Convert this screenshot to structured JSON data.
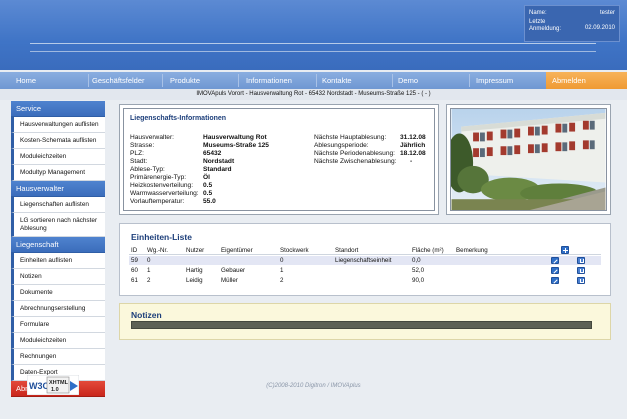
{
  "user": {
    "name_label": "Name:",
    "name_value": "tester",
    "last_login_label_1": "Letzte",
    "last_login_label_2": "Anmeldung:",
    "last_login_value": "02.09.2010"
  },
  "nav": [
    {
      "label": "Home"
    },
    {
      "label": "Geschäftsfelder"
    },
    {
      "label": "Produkte"
    },
    {
      "label": "Informationen"
    },
    {
      "label": "Kontakte"
    },
    {
      "label": "Demo"
    },
    {
      "label": "Impressum"
    },
    {
      "label": "Abmelden"
    }
  ],
  "breadcrumb": "IMOVApuls Vorort - Hausverwaltung Rot - 65432 Nordstadt - Museums-Straße 125 - ( - )",
  "sidebar": {
    "service_title": "Service",
    "service_items": [
      "Hausverwaltungen auflisten",
      "Kosten-Schemata auflisten",
      "Moduleichzeiten",
      "Modultyp Management"
    ],
    "hausverwalter_title": "Hausverwalter",
    "hausverwalter_items": [
      "Liegenschaften auflisten",
      "LG sortieren nach nächster Ablesung"
    ],
    "liegenschaft_title": "Liegenschaft",
    "liegenschaft_items": [
      "Einheiten auflisten",
      "Notizen",
      "Dokumente",
      "Abrechnungserstellung",
      "Formulare",
      "Moduleichzeiten",
      "Rechnungen",
      "Daten-Export"
    ],
    "logout": "Abmelden"
  },
  "info": {
    "title": "Liegenschafts-Informationen",
    "left": [
      {
        "label": "Hausverwalter:",
        "value": "Hausverwaltung Rot"
      },
      {
        "label": "Strasse:",
        "value": "Museums-Straße 125"
      },
      {
        "label": "PLZ:",
        "value": "65432"
      },
      {
        "label": "Stadt:",
        "value": "Nordstadt"
      },
      {
        "label": "Ablese-Typ:",
        "value": "Standard"
      },
      {
        "label": "Primärenergie-Typ:",
        "value": "Öl"
      },
      {
        "label": "Heizkostenverteilung:",
        "value": "0.5"
      },
      {
        "label": "Warmwasserverteilung:",
        "value": "0.5"
      },
      {
        "label": "Vorlauftemperatur:",
        "value": "55.0"
      }
    ],
    "right": [
      {
        "label": "Nächste Hauptablesung:",
        "value": "31.12.08"
      },
      {
        "label": "Ablesungsperiode:",
        "value": "Jährlich"
      },
      {
        "label": "Nächste Periodenablesung:",
        "value": "18.12.08"
      },
      {
        "label": "Nächste Zwischenablesung:",
        "value": "-"
      }
    ]
  },
  "units": {
    "title": "Einheiten-Liste",
    "headers": [
      "ID",
      "Wg.-Nr.",
      "Nutzer",
      "Eigentümer",
      "Stockwerk",
      "Standort",
      "Fläche (m²)",
      "Bemerkung"
    ],
    "rows": [
      [
        "59",
        "0",
        "",
        "",
        "0",
        "Liegenschaftseinheit",
        "0,0",
        ""
      ],
      [
        "60",
        "1",
        "Hartig",
        "Gebauer",
        "1",
        "",
        "52,0",
        ""
      ],
      [
        "61",
        "2",
        "Leidig",
        "Müller",
        "2",
        "",
        "90,0",
        ""
      ]
    ]
  },
  "notes": {
    "title": "Notizen"
  },
  "footer": "(C)2008-2010 Digitron / IMOVAplus",
  "badge": {
    "w3c": "W3C",
    "xhtml": "XHTML",
    "version": "1.0"
  },
  "colors": {
    "header_blue": "#3f74c6",
    "nav_blue": "#7aa0d8",
    "logout_orange": "#f0a040",
    "sidebar_red": "#d1301f",
    "title_blue": "#1c3e7a"
  }
}
